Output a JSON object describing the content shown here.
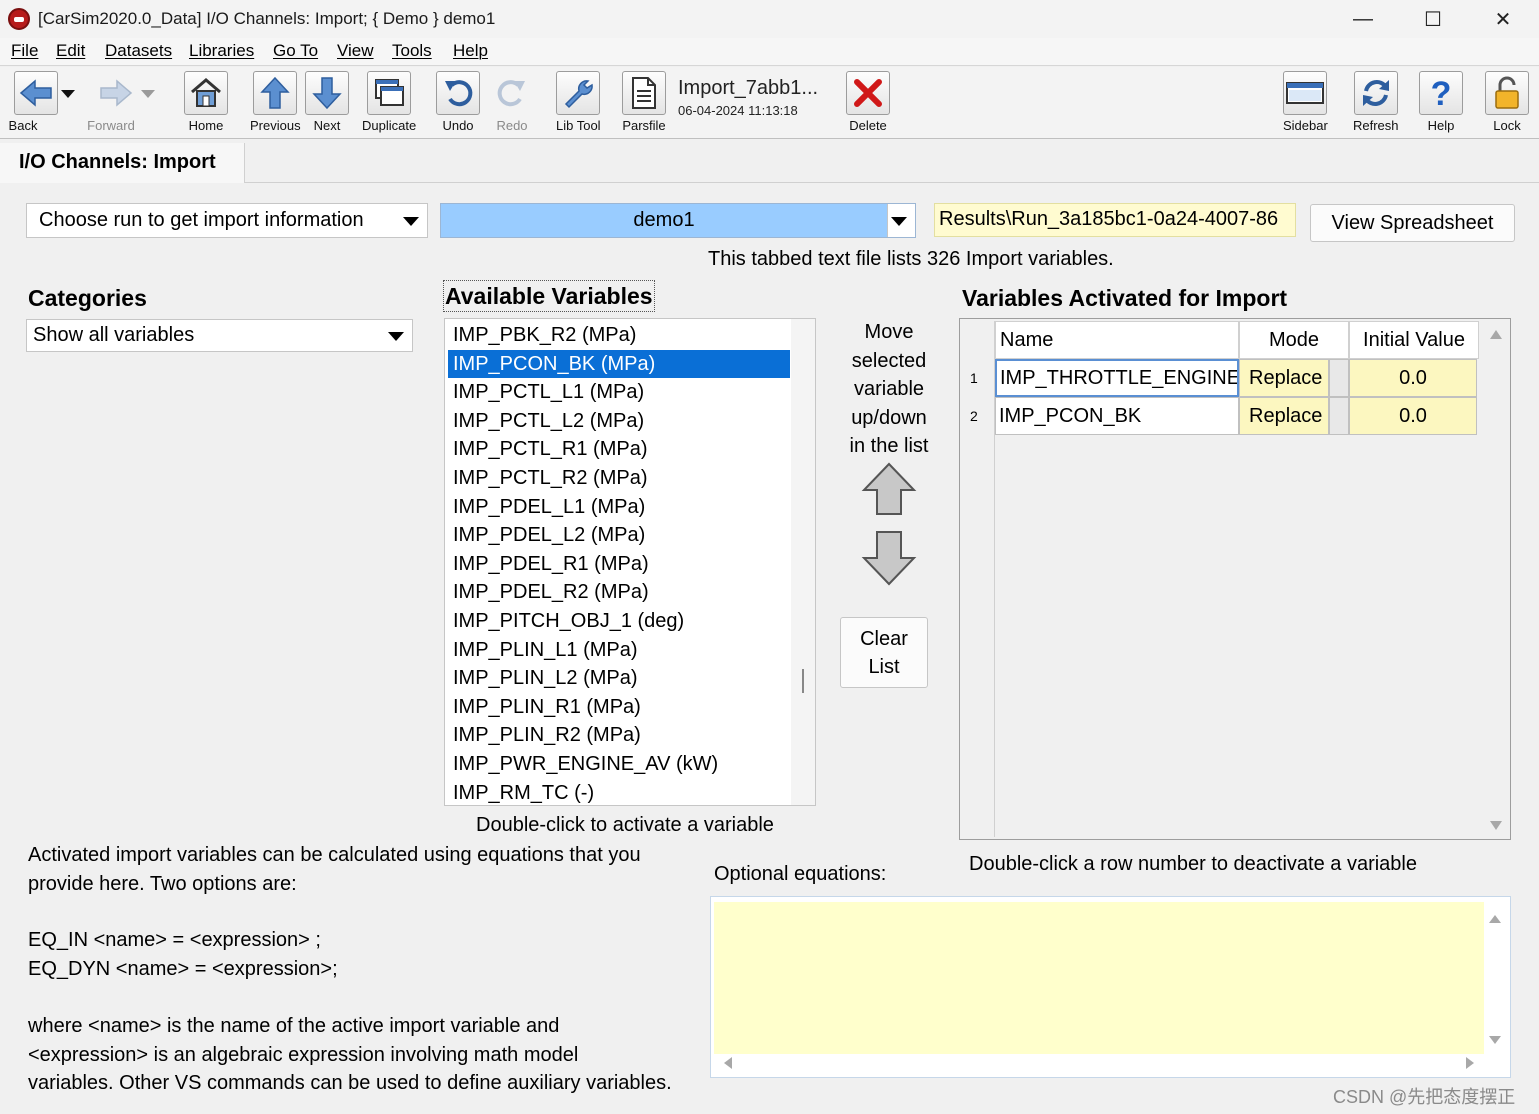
{
  "window": {
    "title": "[CarSim2020.0_Data] I/O Channels: Import; { Demo } demo1",
    "minimize": "—",
    "maximize": "☐",
    "close": "✕"
  },
  "menu": [
    "File",
    "Edit",
    "Datasets",
    "Libraries",
    "Go To",
    "View",
    "Tools",
    "Help"
  ],
  "toolbar": {
    "back": "Back",
    "forward": "Forward",
    "home": "Home",
    "previous": "Previous",
    "next": "Next",
    "duplicate": "Duplicate",
    "undo": "Undo",
    "redo": "Redo",
    "lib_tool": "Lib Tool",
    "parsfile": "Parsfile",
    "parsfile_name": "Import_7abb1...",
    "parsfile_date": "06-04-2024 11:13:18",
    "delete": "Delete",
    "sidebar": "Sidebar",
    "refresh": "Refresh",
    "help": "Help",
    "lock": "Lock"
  },
  "tab": {
    "title": "I/O Channels: Import"
  },
  "run_select": {
    "placeholder": "Choose run to get import information",
    "dataset": "demo1",
    "results_path": "Results\\Run_3a185bc1-0a24-4007-86",
    "view_spreadsheet": "View Spreadsheet",
    "info": "This tabbed text file lists 326 Import variables."
  },
  "categories": {
    "heading": "Categories",
    "selected": "Show all variables"
  },
  "available": {
    "heading": "Available Variables",
    "items": [
      "IMP_PBK_R2 (MPa)",
      "IMP_PCON_BK (MPa)",
      "IMP_PCTL_L1 (MPa)",
      "IMP_PCTL_L2 (MPa)",
      "IMP_PCTL_R1 (MPa)",
      "IMP_PCTL_R2 (MPa)",
      "IMP_PDEL_L1 (MPa)",
      "IMP_PDEL_L2 (MPa)",
      "IMP_PDEL_R1 (MPa)",
      "IMP_PDEL_R2 (MPa)",
      "IMP_PITCH_OBJ_1 (deg)",
      "IMP_PLIN_L1 (MPa)",
      "IMP_PLIN_L2 (MPa)",
      "IMP_PLIN_R1 (MPa)",
      "IMP_PLIN_R2 (MPa)",
      "IMP_PWR_ENGINE_AV (kW)",
      "IMP_RM_TC (-)"
    ],
    "selected_index": 1,
    "hint": "Double-click to activate a variable"
  },
  "move": {
    "lines": [
      "Move",
      "selected",
      "variable",
      "up/down",
      "in the list"
    ],
    "clear_line1": "Clear",
    "clear_line2": "List"
  },
  "activated": {
    "heading": "Variables Activated for Import",
    "columns": {
      "name": "Name",
      "mode": "Mode",
      "initial": "Initial Value"
    },
    "rows": [
      {
        "num": "1",
        "name": "IMP_THROTTLE_ENGINE",
        "mode": "Replace",
        "value": "0.0"
      },
      {
        "num": "2",
        "name": "IMP_PCON_BK",
        "mode": "Replace",
        "value": "0.0"
      }
    ],
    "hint": "Double-click a row number to deactivate a variable"
  },
  "help_text": {
    "p1_line1": "Activated import variables can be calculated using equations that you",
    "p1_line2": "provide here. Two options are:",
    "eq1": "EQ_IN <name> = <expression> ;",
    "eq2": "EQ_DYN <name> = <expression>;",
    "p2_line1": "where <name> is the name of the active import variable and",
    "p2_line2": "<expression> is an algebraic expression involving math model",
    "p2_line3": "variables. Other VS commands can be used to define auxiliary variables."
  },
  "equations": {
    "label": "Optional equations:",
    "value": ""
  },
  "watermark": "CSDN @先把态度摆正",
  "colors": {
    "selection": "#0a6fd6",
    "dataset_bg": "#99ccff",
    "yellow_field": "#fffbd0",
    "equations_bg": "#ffffcc"
  }
}
